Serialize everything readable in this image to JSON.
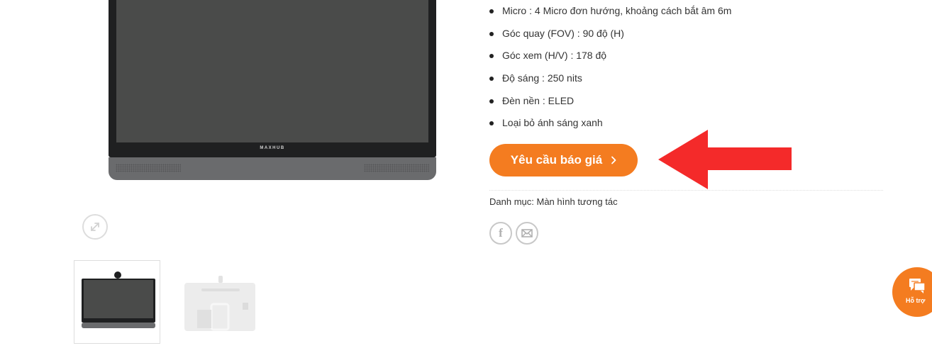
{
  "product": {
    "main_image": {
      "brand_logo": "MAXHUB",
      "zoom_icon": "expand-icon"
    },
    "thumbnails": [
      {
        "name": "front-view"
      },
      {
        "name": "back-view"
      }
    ],
    "specs": [
      "Micro : 4 Micro đơn hướng, khoảng cách bắt âm 6m",
      "Góc quay (FOV) : 90 độ (H)",
      "Góc xem (H/V) : 178 độ",
      "Độ sáng : 250 nits",
      "Đèn nền : ELED",
      "Loại bỏ ánh sáng xanh"
    ],
    "cta": {
      "label": "Yêu cầu báo giá",
      "icon": "chevron-right-icon"
    },
    "category": {
      "label": "Danh mục:",
      "value": "Màn hình tương tác"
    },
    "share": {
      "facebook_icon": "f",
      "email_icon": "envelope-icon"
    }
  },
  "support": {
    "label": "Hỗ trợ",
    "icon": "chat-icon"
  },
  "colors": {
    "accent": "#f47c20",
    "annotation_arrow": "#f42a2a",
    "text": "#333333",
    "screen": "#4a4b4a"
  }
}
